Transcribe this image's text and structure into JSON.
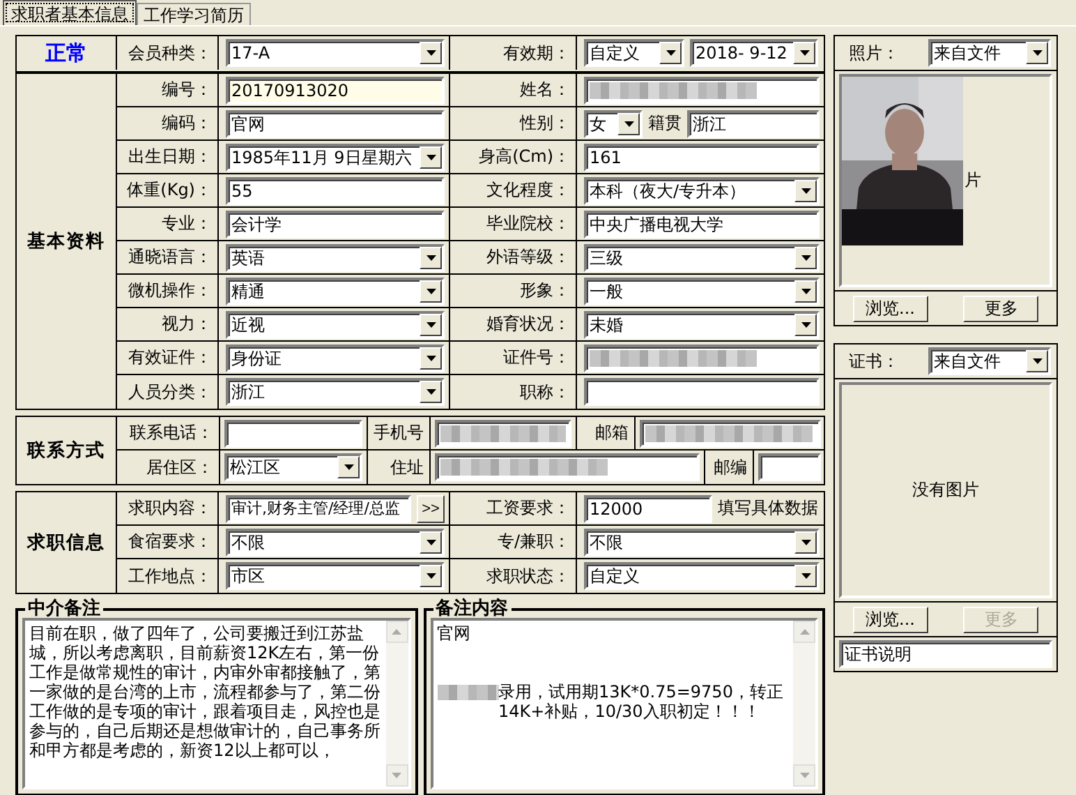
{
  "tabs": [
    {
      "label": "求职者基本信息",
      "selected": true
    },
    {
      "label": "工作学习简历",
      "selected": false
    }
  ],
  "header": {
    "status": "正常",
    "member_label": "会员种类：",
    "member_value": "17-A",
    "validity_label": "有效期：",
    "validity_mode": "自定义",
    "validity_date": "2018- 9-12"
  },
  "basic": {
    "title": "基本资料",
    "rows": [
      {
        "left": {
          "label": "编号：",
          "kind": "readonly",
          "value": "20170913020"
        },
        "right": {
          "label": "姓名：",
          "kind": "redacted"
        }
      },
      {
        "left": {
          "label": "编码：",
          "kind": "text",
          "value": "官网"
        },
        "right": {
          "label": "性别：",
          "kind": "split",
          "value": "女",
          "extra_label": "籍贯",
          "extra_value": "浙江"
        }
      },
      {
        "left": {
          "label": "出生日期：",
          "kind": "combo",
          "value": "1985年11月 9日星期六"
        },
        "right": {
          "label": "身高(Cm)：",
          "kind": "text",
          "value": "161"
        }
      },
      {
        "left": {
          "label": "体重(Kg)：",
          "kind": "text",
          "value": "55"
        },
        "right": {
          "label": "文化程度：",
          "kind": "combo",
          "value": "本科（夜大/专升本）"
        }
      },
      {
        "left": {
          "label": "专业：",
          "kind": "text",
          "value": "会计学"
        },
        "right": {
          "label": "毕业院校：",
          "kind": "text",
          "value": "中央广播电视大学"
        }
      },
      {
        "left": {
          "label": "通晓语言：",
          "kind": "combo",
          "value": "英语"
        },
        "right": {
          "label": "外语等级：",
          "kind": "combo",
          "value": "三级"
        }
      },
      {
        "left": {
          "label": "微机操作：",
          "kind": "combo",
          "value": "精通"
        },
        "right": {
          "label": "形象：",
          "kind": "combo",
          "value": "一般"
        }
      },
      {
        "left": {
          "label": "视力：",
          "kind": "combo",
          "value": "近视"
        },
        "right": {
          "label": "婚育状况：",
          "kind": "combo",
          "value": "未婚"
        }
      },
      {
        "left": {
          "label": "有效证件：",
          "kind": "combo",
          "value": "身份证"
        },
        "right": {
          "label": "证件号：",
          "kind": "redacted"
        }
      },
      {
        "left": {
          "label": "人员分类：",
          "kind": "combo",
          "value": "浙江"
        },
        "right": {
          "label": "职称：",
          "kind": "text"
        }
      }
    ]
  },
  "contact": {
    "title": "联系方式",
    "rows": [
      [
        {
          "label": "联系电话：",
          "kind": "text"
        },
        {
          "label": "手机号",
          "kind": "redacted"
        },
        {
          "label": "邮箱",
          "kind": "redacted"
        }
      ],
      [
        {
          "label": "居住区：",
          "kind": "combo",
          "value": "松江区"
        },
        {
          "label": "住址",
          "kind": "redacted"
        },
        {
          "label": "邮编",
          "kind": "text"
        }
      ]
    ]
  },
  "job": {
    "title": "求职信息",
    "rows": [
      {
        "left": {
          "label": "求职内容：",
          "kind": "picker",
          "value": "审计,财务主管/经理/总监",
          "button": ">>"
        },
        "right": {
          "label": "工资要求：",
          "kind": "note",
          "value": "12000",
          "note": "填写具体数据"
        }
      },
      {
        "left": {
          "label": "食宿要求：",
          "kind": "combo",
          "value": "不限"
        },
        "right": {
          "label": "专/兼职：",
          "kind": "combo",
          "value": "不限"
        }
      },
      {
        "left": {
          "label": "工作地点：",
          "kind": "combo",
          "value": "市区"
        },
        "right": {
          "label": "求职状态：",
          "kind": "combo",
          "value": "自定义"
        }
      }
    ]
  },
  "notes": [
    {
      "title": "中介备注",
      "lines": [
        {
          "kind": "text",
          "text": "目前在职，做了四年了，公司要搬迁到江苏盐城，所以考虑离职，目前薪资12K左右，第一份工作是做常规性的审计，内审外审都接触了，第一家做的是台湾的上市，流程都参与了，第二份工作做的是专项的审计，跟着项目走，风控也是参与的，自己后期还是想做审计的，自己事务所和甲方都是考虑的，新资12以上都可以，"
        }
      ]
    },
    {
      "title": "备注内容",
      "lines": [
        {
          "kind": "text",
          "text": "官网"
        },
        {
          "kind": "blank"
        },
        {
          "kind": "blank"
        },
        {
          "kind": "redacted_prefix",
          "text": "录用，试用期13K*0.75=9750，转正14K+补贴，10/30入职初定！！！"
        }
      ]
    }
  ],
  "photo": {
    "label": "照片：",
    "source": "来自文件",
    "overlay_text": "片",
    "buttons": [
      {
        "label": "浏览...",
        "disabled": false
      },
      {
        "label": "更多",
        "disabled": false
      }
    ]
  },
  "certificate": {
    "label": "证书：",
    "source": "来自文件",
    "empty_text": "没有图片",
    "buttons": [
      {
        "label": "浏览...",
        "disabled": false
      },
      {
        "label": "更多",
        "disabled": true
      }
    ],
    "caption": "证书说明"
  }
}
